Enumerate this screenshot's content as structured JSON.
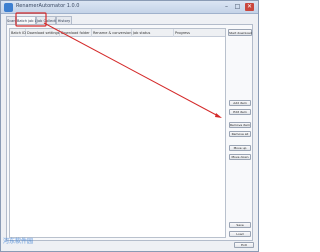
{
  "window": {
    "title": "RenamerAutomator 1.0.0",
    "minimize_glyph": "–",
    "maximize_glyph": "□",
    "close_glyph": "✕"
  },
  "tabs": [
    {
      "label": "Scan"
    },
    {
      "label": "Batch job List"
    },
    {
      "label": "Job Collection"
    },
    {
      "label": "History"
    }
  ],
  "table": {
    "columns": [
      "Batch ID",
      "Download settings",
      "Download folder",
      "Rename & conversion",
      "Job status",
      "Progress"
    ]
  },
  "buttons": {
    "start_download": "Start download",
    "add_item": "Add item",
    "edit_item": "Edit item",
    "remove_item": "Remove item",
    "remove_all": "Remove all",
    "move_up": "Move up",
    "move_down": "Move down",
    "save": "Save",
    "load": "Load",
    "exit": "Exit"
  },
  "watermark": "河东软件园",
  "colors": {
    "annotation_red": "#d42a2a"
  }
}
